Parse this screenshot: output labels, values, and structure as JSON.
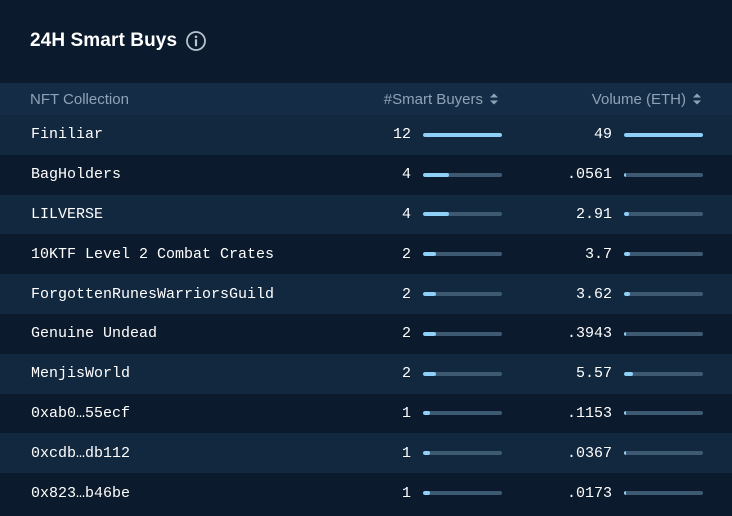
{
  "header": {
    "title": "24H Smart Buys",
    "info_icon": "info-circle-icon"
  },
  "colors": {
    "background": "#0b1a2c",
    "row_alt": "#12283f",
    "header_bg": "#142c45",
    "bar_track": "#3e5a72",
    "bar_fill": "#8ed0f7"
  },
  "table": {
    "columns": {
      "collection": "NFT Collection",
      "buyers": "#Smart Buyers",
      "volume": "Volume (ETH)"
    },
    "max_buyers": 12,
    "max_volume": 49,
    "rows": [
      {
        "name": "Finiliar",
        "buyers": "12",
        "buyers_value": 12,
        "volume": "49",
        "volume_value": 49
      },
      {
        "name": "BagHolders",
        "buyers": "4",
        "buyers_value": 4,
        "volume": ".0561",
        "volume_value": 0.0561
      },
      {
        "name": "LILVERSE",
        "buyers": "4",
        "buyers_value": 4,
        "volume": "2.91",
        "volume_value": 2.91
      },
      {
        "name": "10KTF Level 2 Combat Crates",
        "buyers": "2",
        "buyers_value": 2,
        "volume": "3.7",
        "volume_value": 3.7
      },
      {
        "name": "ForgottenRunesWarriorsGuild",
        "buyers": "2",
        "buyers_value": 2,
        "volume": "3.62",
        "volume_value": 3.62
      },
      {
        "name": "Genuine Undead",
        "buyers": "2",
        "buyers_value": 2,
        "volume": ".3943",
        "volume_value": 0.3943
      },
      {
        "name": "MenjisWorld",
        "buyers": "2",
        "buyers_value": 2,
        "volume": "5.57",
        "volume_value": 5.57
      },
      {
        "name": "0xab0…55ecf",
        "buyers": "1",
        "buyers_value": 1,
        "volume": ".1153",
        "volume_value": 0.1153
      },
      {
        "name": "0xcdb…db112",
        "buyers": "1",
        "buyers_value": 1,
        "volume": ".0367",
        "volume_value": 0.0367
      },
      {
        "name": "0x823…b46be",
        "buyers": "1",
        "buyers_value": 1,
        "volume": ".0173",
        "volume_value": 0.0173
      }
    ]
  }
}
